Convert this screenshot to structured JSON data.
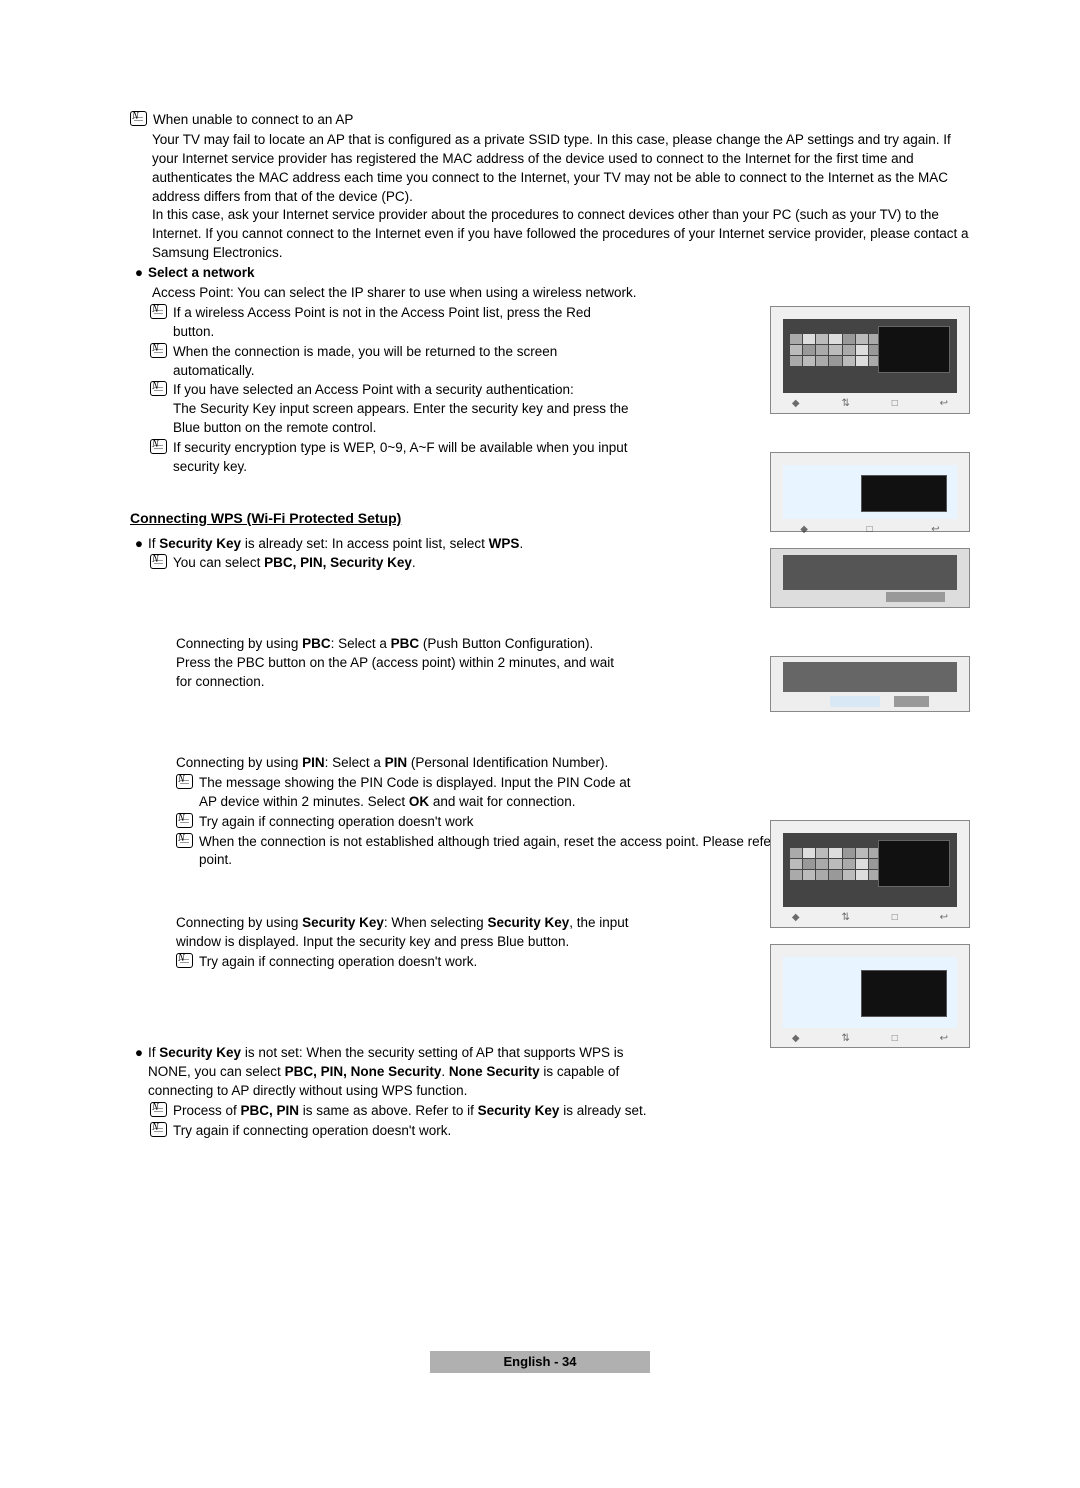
{
  "unable_ap": "When unable to connect to an AP",
  "unable_p1": "Your TV may fail to locate an AP that is configured as a private SSID type. In this case, please change the AP settings and try again. If your Internet service provider has registered the MAC address of the device used to connect to the Internet for the first time and authenticates the MAC address each time you connect to the Internet, your TV may not be able to connect to the Internet as the MAC address differs from that of the device (PC).",
  "unable_p2": "In this case, ask your Internet service provider about the procedures to connect devices other than your PC (such as your TV) to the Internet. If you cannot connect to the Internet even if you have followed the procedures of your Internet service provider, please contact a Samsung Electronics.",
  "select_net": "Select a network",
  "select_p": "Access Point: You can select the IP sharer to use when using a wireless network.",
  "sel_n1": "If a wireless Access Point is not in the Access Point list, press the Red button.",
  "sel_n2": "When the connection is made, you will be returned to the screen automatically.",
  "sel_n3": "If you have selected an Access Point with a security authentication:",
  "sel_n3b": "The Security Key input screen appears. Enter the security key and press the Blue button on the remote control.",
  "sel_n4": "If security encryption type is WEP, 0~9, A~F will be available when you input security key.",
  "wps_heading": "Connecting WPS (Wi-Fi Protected Setup)",
  "wps_if_set_pre": "If ",
  "wps_if_set_b": "Security Key",
  "wps_if_set_post": " is already set: In access point list, select ",
  "wps_if_set_b2": "WPS",
  "wps_n1_pre": "You can select ",
  "wps_n1_b": "PBC, PIN, Security Key",
  "pbc_pre": "Connecting by using ",
  "pbc_b": "PBC",
  "pbc_post": ": Select a ",
  "pbc_b2": "PBC",
  "pbc_after": " (Push Button Configuration). Press the PBC button on the AP (access point) within 2 minutes, and wait for connection.",
  "pin_pre": "Connecting by using ",
  "pin_b": "PIN",
  "pin_post": ": Select a ",
  "pin_b2": "PIN",
  "pin_after": " (Personal Identification Number).",
  "pin_n1_pre": "The message showing the PIN Code is displayed. Input the PIN Code at AP device within 2 minutes. Select ",
  "pin_n1_b": "OK",
  "pin_n1_post": " and wait for connection.",
  "pin_n2": "Try again if connecting operation doesn't work",
  "pin_n3": "When the connection is not established although tried again, reset the access point. Please refer to a manual of each access point.",
  "sk_pre": "Connecting by using ",
  "sk_b": "Security Key",
  "sk_post": ": When selecting ",
  "sk_b2": "Security Key",
  "sk_after": ", the input window is displayed. Input the security key and press Blue button.",
  "sk_n1": "Try again if connecting operation doesn't work.",
  "not_set_pre": "If ",
  "not_set_b": "Security Key",
  "not_set_post": " is not set: When the security setting of AP that supports WPS is NONE, you can select ",
  "not_set_b2": "PBC, PIN, None Security",
  "not_set_post2": ". ",
  "not_set_b3": "None Security",
  "not_set_after": " is capable of connecting to AP directly without using WPS function.",
  "ns_n1_pre": "Process of ",
  "ns_n1_b": "PBC, PIN",
  "ns_n1_post": " is same as above. Refer to if ",
  "ns_n1_b2": "Security Key",
  "ns_n1_after": " is already set.",
  "ns_n2": "Try again if connecting operation doesn't work.",
  "footer": "English - 34"
}
